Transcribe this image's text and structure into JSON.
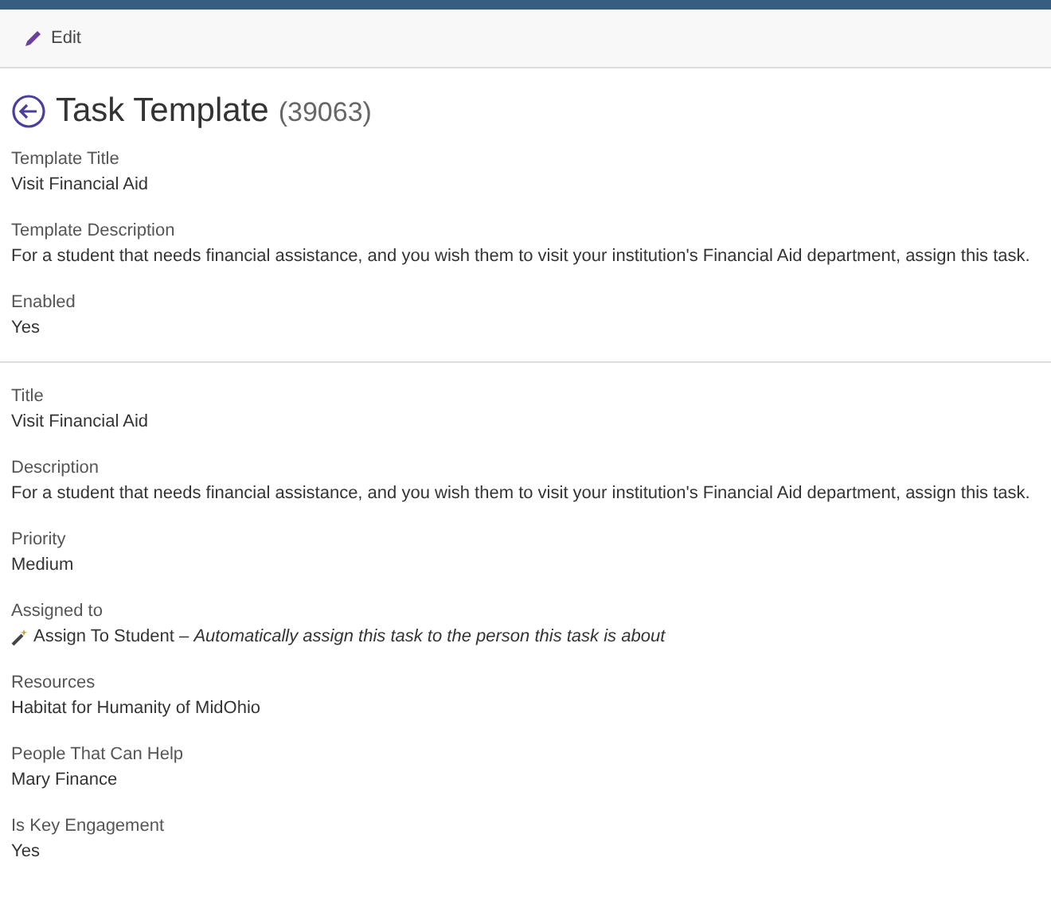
{
  "toolbar": {
    "edit_label": "Edit"
  },
  "heading": {
    "title": "Task Template",
    "id": "(39063)"
  },
  "sections": [
    {
      "fields": [
        {
          "label": "Template Title",
          "value": "Visit Financial Aid"
        },
        {
          "label": "Template Description",
          "value": "For a student that needs financial assistance, and you wish them to visit your institution's Financial Aid department, assign this task."
        },
        {
          "label": "Enabled",
          "value": "Yes"
        }
      ]
    },
    {
      "fields": [
        {
          "label": "Title",
          "value": "Visit Financial Aid"
        },
        {
          "label": "Description",
          "value": "For a student that needs financial assistance, and you wish them to visit your institution's Financial Aid department, assign this task."
        },
        {
          "label": "Priority",
          "value": "Medium"
        },
        {
          "label": "Assigned to",
          "kind": "auto",
          "value": "Assign To Student – *Automatically assign this task to the person this task is about*"
        },
        {
          "label": "Resources",
          "value": "Habitat for Humanity of MidOhio"
        },
        {
          "label": "People That Can Help",
          "value": "Mary Finance"
        },
        {
          "label": "Is Key Engagement",
          "value": "Yes"
        }
      ]
    }
  ]
}
